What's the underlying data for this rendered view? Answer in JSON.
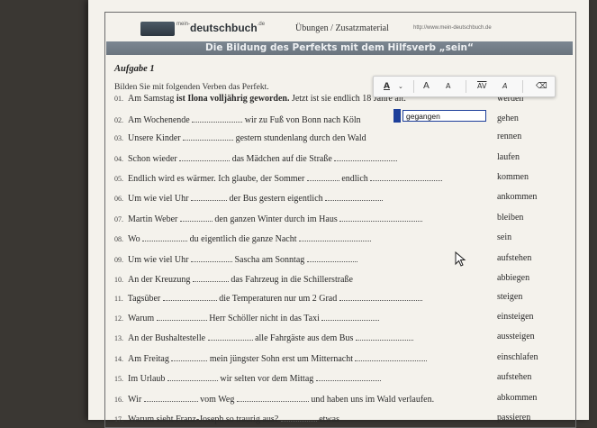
{
  "header": {
    "logo": "deutschbuch",
    "crumb": "Übungen / Zusatzmaterial",
    "url": "http://www.mein-deutschbuch.de"
  },
  "title": "Die Bildung des Perfekts mit dem Hilfsverb „sein“",
  "aufgabe": "Aufgabe 1",
  "instruction": "Bilden Sie mit folgenden Verben das Perfekt.",
  "toolbar": {
    "items": [
      "A",
      "⌄",
      "A",
      "A",
      "AV",
      "A",
      "⌫"
    ]
  },
  "input": {
    "value": "gegangen"
  },
  "sentences": [
    {
      "num": "01.",
      "a": "Am Samstag",
      "bold": " ist Ilona volljährig geworden.",
      "b": " Jetzt ist sie endlich 18 Jahre alt.",
      "verb": "werden"
    },
    {
      "num": "02.",
      "a": "Am Wochenende ",
      "b": " wir zu Fuß von Bonn nach Köln ",
      "verb": "gehen"
    },
    {
      "num": "03.",
      "a": "Unsere Kinder ",
      "b": " gestern stundenlang durch den Wald ",
      "verb": "rennen"
    },
    {
      "num": "04.",
      "a": "Schon wieder ",
      "b": " das Mädchen auf die Straße ",
      "verb": "laufen"
    },
    {
      "num": "05.",
      "a": "Endlich wird es wärmer. Ich glaube, der Sommer ",
      "b": " endlich ",
      "verb": "kommen"
    },
    {
      "num": "06.",
      "a": "Um wie viel Uhr ",
      "b": " der Bus gestern eigentlich ",
      "verb": "ankommen"
    },
    {
      "num": "07.",
      "a": "Martin Weber ",
      "b": " den ganzen Winter durch im Haus ",
      "verb": "bleiben"
    },
    {
      "num": "08.",
      "a": "Wo ",
      "b": " du eigentlich die ganze Nacht ",
      "verb": "sein"
    },
    {
      "num": "09.",
      "a": "Um wie viel Uhr ",
      "b": " Sascha am Sonntag ",
      "verb": "aufstehen"
    },
    {
      "num": "10.",
      "a": "An der Kreuzung ",
      "b": " das Fahrzeug in die Schillerstraße ",
      "verb": "abbiegen"
    },
    {
      "num": "11.",
      "a": "Tagsüber ",
      "b": " die Temperaturen nur um 2 Grad ",
      "verb": "steigen"
    },
    {
      "num": "12.",
      "a": "Warum ",
      "b": " Herr Schöller nicht in das Taxi ",
      "verb": "einsteigen"
    },
    {
      "num": "13.",
      "a": "An der Bushaltestelle ",
      "b": " alle Fahrgäste aus dem Bus ",
      "verb": "aussteigen"
    },
    {
      "num": "14.",
      "a": "Am Freitag ",
      "b": " mein jüngster Sohn erst um Mitternacht ",
      "verb": "einschlafen"
    },
    {
      "num": "15.",
      "a": "Im Urlaub ",
      "b": " wir selten vor dem Mittag ",
      "verb": "aufstehen"
    },
    {
      "num": "16.",
      "a": "Wir ",
      "b": " vom Weg ",
      "c": " und haben uns im Wald verlaufen.",
      "verb": "abkommen"
    },
    {
      "num": "17.",
      "a": "Warum sieht Franz-Joseph so traurig aus? ",
      "b": " etwas ",
      "verb": "passieren"
    }
  ]
}
